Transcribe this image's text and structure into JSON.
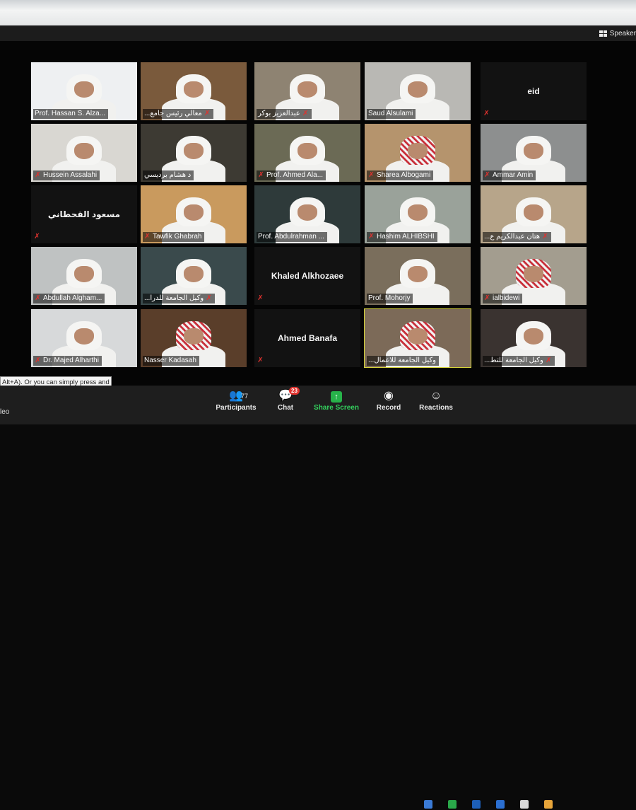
{
  "view_button": {
    "label": "Speaker"
  },
  "tiles": [
    {
      "name": "Prof. Hassan S. Alza...",
      "muted": false,
      "dir": "ltr",
      "bg": "#eef0f2"
    },
    {
      "name": "معالي رئيس جامع...",
      "muted": true,
      "dir": "rtl",
      "bg": "#7a5a3c"
    },
    {
      "name": "عبدالعزيز بوكر",
      "muted": true,
      "dir": "rtl",
      "bg": "#8e8372"
    },
    {
      "name": "Saud Alsulami",
      "muted": false,
      "dir": "ltr",
      "bg": "#b9b8b4"
    },
    {
      "name": "eid",
      "muted": true,
      "dir": "ltr",
      "bg": ""
    },
    {
      "name": "Hussein Assalahi",
      "muted": true,
      "dir": "ltr",
      "bg": "#d9d7d2"
    },
    {
      "name": "د هشام برديسي",
      "muted": false,
      "dir": "rtl",
      "bg": "#3d3a33"
    },
    {
      "name": "Prof. Ahmed Ala...",
      "muted": true,
      "dir": "ltr",
      "bg": "#6b6a55"
    },
    {
      "name": "Sharea Albogami",
      "muted": true,
      "dir": "ltr",
      "bg": "#b5946d"
    },
    {
      "name": "Ammar Amin",
      "muted": true,
      "dir": "ltr",
      "bg": "#8d8f8f"
    },
    {
      "name": "مسعود القحطاني",
      "muted": true,
      "dir": "rtl",
      "bg": ""
    },
    {
      "name": "Tawfik Ghabrah",
      "muted": true,
      "dir": "ltr",
      "bg": "#c99a5e"
    },
    {
      "name": "Prof. Abdulrahman ...",
      "muted": false,
      "dir": "ltr",
      "bg": "#2e3a3a"
    },
    {
      "name": "Hashim ALHIBSHI",
      "muted": true,
      "dir": "ltr",
      "bg": "#9aa29a"
    },
    {
      "name": "هتان عبدالكريم ع...",
      "muted": true,
      "dir": "rtl",
      "bg": "#b7a58a"
    },
    {
      "name": "Abdullah Algham...",
      "muted": true,
      "dir": "ltr",
      "bg": "#bfc2c2"
    },
    {
      "name": "وكيل الجامعة للدرا...",
      "muted": true,
      "dir": "rtl",
      "bg": "#3a4a4c"
    },
    {
      "name": "Khaled Alkhozaee",
      "muted": true,
      "dir": "ltr",
      "bg": ""
    },
    {
      "name": "Prof. Mohorjy",
      "muted": false,
      "dir": "ltr",
      "bg": "#7a6e5c"
    },
    {
      "name": "ialbidewi",
      "muted": true,
      "dir": "ltr",
      "bg": "#a39d8f"
    },
    {
      "name": "Dr. Majed Alharthi",
      "muted": true,
      "dir": "ltr",
      "bg": "#d7d9da"
    },
    {
      "name": "Nasser Kadasah",
      "muted": false,
      "dir": "ltr",
      "bg": "#5a3e2a"
    },
    {
      "name": "Ahmed Banafa",
      "muted": true,
      "dir": "ltr",
      "bg": ""
    },
    {
      "name": "وكيل الجامعة للاعمال...",
      "muted": false,
      "dir": "rtl",
      "bg": "#7c6a58",
      "active": true
    },
    {
      "name": "وكيل الجامعة للتط...",
      "muted": true,
      "dir": "rtl",
      "bg": "#3a3330"
    }
  ],
  "tooltip": {
    "text": "Alt+A). Or you can simply press and temporarily unmute."
  },
  "left_label": "leo",
  "toolbar": {
    "participants_label": "Participants",
    "participants_count": "77",
    "chat_label": "Chat",
    "chat_badge": "23",
    "share_label": "Share Screen",
    "record_label": "Record",
    "reactions_label": "Reactions"
  },
  "colors": {
    "mute_red": "#e0322e",
    "share_green": "#27b34a",
    "active_border": "#d7d63c"
  }
}
